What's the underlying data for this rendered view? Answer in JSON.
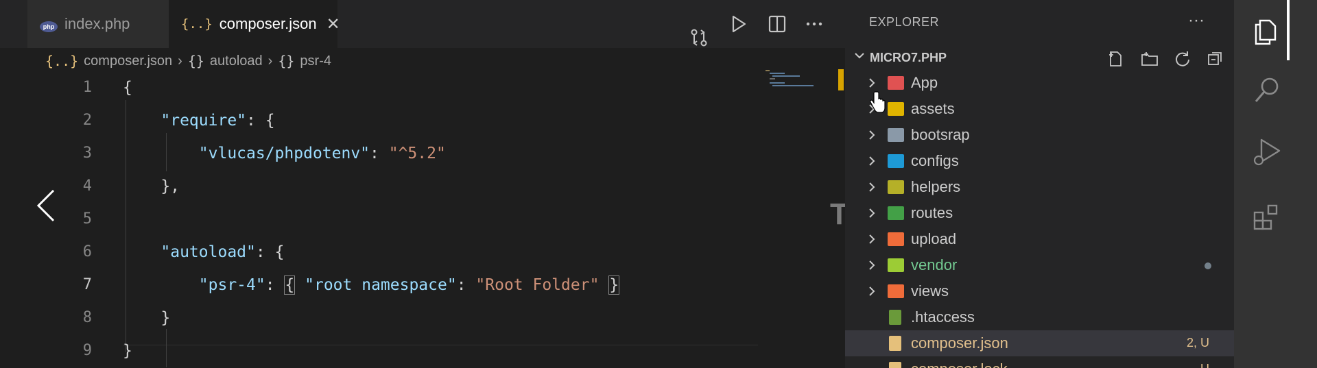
{
  "tabs": [
    {
      "label": "index.php",
      "icon": "php-file-icon",
      "active": false
    },
    {
      "label": "composer.json",
      "icon": "json-file-icon",
      "active": true,
      "close": "✕"
    }
  ],
  "editor_actions": [
    "open-changes-icon",
    "run-icon",
    "split-editor-icon",
    "more-actions-icon"
  ],
  "breadcrumb": [
    {
      "label": "composer.json",
      "icon": "{..}"
    },
    {
      "label": "autoload",
      "icon": "{}"
    },
    {
      "label": "psr-4",
      "icon": "{}"
    }
  ],
  "code": {
    "lines": [
      {
        "n": "1",
        "tokens": [
          {
            "t": "{",
            "c": "p"
          }
        ]
      },
      {
        "n": "2",
        "tokens": [
          {
            "t": "    ",
            "c": "p"
          },
          {
            "t": "\"require\"",
            "c": "k"
          },
          {
            "t": ": {",
            "c": "p"
          }
        ]
      },
      {
        "n": "3",
        "tokens": [
          {
            "t": "        ",
            "c": "p"
          },
          {
            "t": "\"vlucas/phpdotenv\"",
            "c": "k"
          },
          {
            "t": ": ",
            "c": "p"
          },
          {
            "t": "\"^5.2\"",
            "c": "s"
          }
        ]
      },
      {
        "n": "4",
        "tokens": [
          {
            "t": "    },",
            "c": "p"
          }
        ]
      },
      {
        "n": "5",
        "tokens": []
      },
      {
        "n": "6",
        "tokens": [
          {
            "t": "    ",
            "c": "p"
          },
          {
            "t": "\"autoload\"",
            "c": "k"
          },
          {
            "t": ": {",
            "c": "p"
          }
        ]
      },
      {
        "n": "7",
        "tokens": [
          {
            "t": "        ",
            "c": "p"
          },
          {
            "t": "\"psr-4\"",
            "c": "k"
          },
          {
            "t": ": ",
            "c": "p"
          },
          {
            "t": "{",
            "c": "p cur"
          },
          {
            "t": " ",
            "c": "p"
          },
          {
            "t": "\"root namespace\"",
            "c": "k"
          },
          {
            "t": ": ",
            "c": "p"
          },
          {
            "t": "\"Root Folder\"",
            "c": "s"
          },
          {
            "t": " ",
            "c": "p"
          },
          {
            "t": "}",
            "c": "p cur"
          }
        ]
      },
      {
        "n": "8",
        "tokens": [
          {
            "t": "    }",
            "c": "p"
          }
        ]
      },
      {
        "n": "9",
        "tokens": [
          {
            "t": "}",
            "c": "p"
          }
        ]
      }
    ],
    "active_line": "7"
  },
  "overlay_glyph": "T",
  "explorer": {
    "title": "EXPLORER",
    "more": "···",
    "project": "MICRO7.PHP",
    "items": [
      {
        "label": "App",
        "type": "folder",
        "color": "#e05252",
        "icon": "app-folder-icon"
      },
      {
        "label": "assets",
        "type": "folder",
        "color": "#e0b400",
        "icon": "assets-folder-icon"
      },
      {
        "label": "bootsrap",
        "type": "folder",
        "color": "#8a99a8",
        "icon": "folder-icon"
      },
      {
        "label": "configs",
        "type": "folder",
        "color": "#1e9ad6",
        "icon": "config-folder-icon"
      },
      {
        "label": "helpers",
        "type": "folder",
        "color": "#b5b028",
        "icon": "helpers-folder-icon"
      },
      {
        "label": "routes",
        "type": "folder",
        "color": "#43a047",
        "icon": "routes-folder-icon"
      },
      {
        "label": "upload",
        "type": "folder",
        "color": "#ef6c3a",
        "icon": "upload-folder-icon"
      },
      {
        "label": "vendor",
        "type": "folder",
        "color": "#9ccc35",
        "icon": "vendor-folder-icon",
        "label_color": "#73c991",
        "dot": true
      },
      {
        "label": "views",
        "type": "folder",
        "color": "#ef6c3a",
        "icon": "views-folder-icon"
      },
      {
        "label": ".htaccess",
        "type": "file",
        "color": "#6a9a3a",
        "icon": "htaccess-file-icon"
      },
      {
        "label": "composer.json",
        "type": "file",
        "color": "#e5c07b",
        "icon": "json-file-icon",
        "label_color": "#e2c08d",
        "status": "2, U",
        "selected": true
      },
      {
        "label": "composer.lock",
        "type": "file",
        "color": "#e5c07b",
        "icon": "lock-file-icon",
        "label_color": "#e2c08d",
        "status": "U"
      }
    ]
  },
  "activity_bar": [
    "explorer-icon",
    "search-icon",
    "run-debug-icon",
    "extensions-icon"
  ]
}
